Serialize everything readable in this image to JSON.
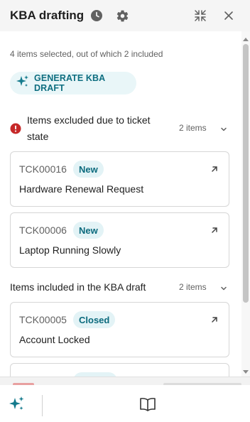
{
  "header": {
    "title": "KBA drafting"
  },
  "summary_text": "4 items selected, out of which 2 included",
  "generate_button_label": "GENERATE KBA DRAFT",
  "excluded_section": {
    "title": "Items excluded due to ticket state",
    "count": "2 items",
    "cards": [
      {
        "ticket_id": "TCK00016",
        "status": "New",
        "title": "Hardware Renewal Request"
      },
      {
        "ticket_id": "TCK00006",
        "status": "New",
        "title": "Laptop Running Slowly"
      }
    ]
  },
  "included_section": {
    "title": "Items included in the KBA draft",
    "count": "2 items",
    "cards": [
      {
        "ticket_id": "TCK00005",
        "status": "Closed",
        "title": "Account Locked"
      }
    ]
  },
  "colors": {
    "accent": "#0e6e80",
    "badge_bg": "#e3f3f6",
    "warning_red": "#c62828",
    "sparkle_teal": "#137a8c"
  }
}
